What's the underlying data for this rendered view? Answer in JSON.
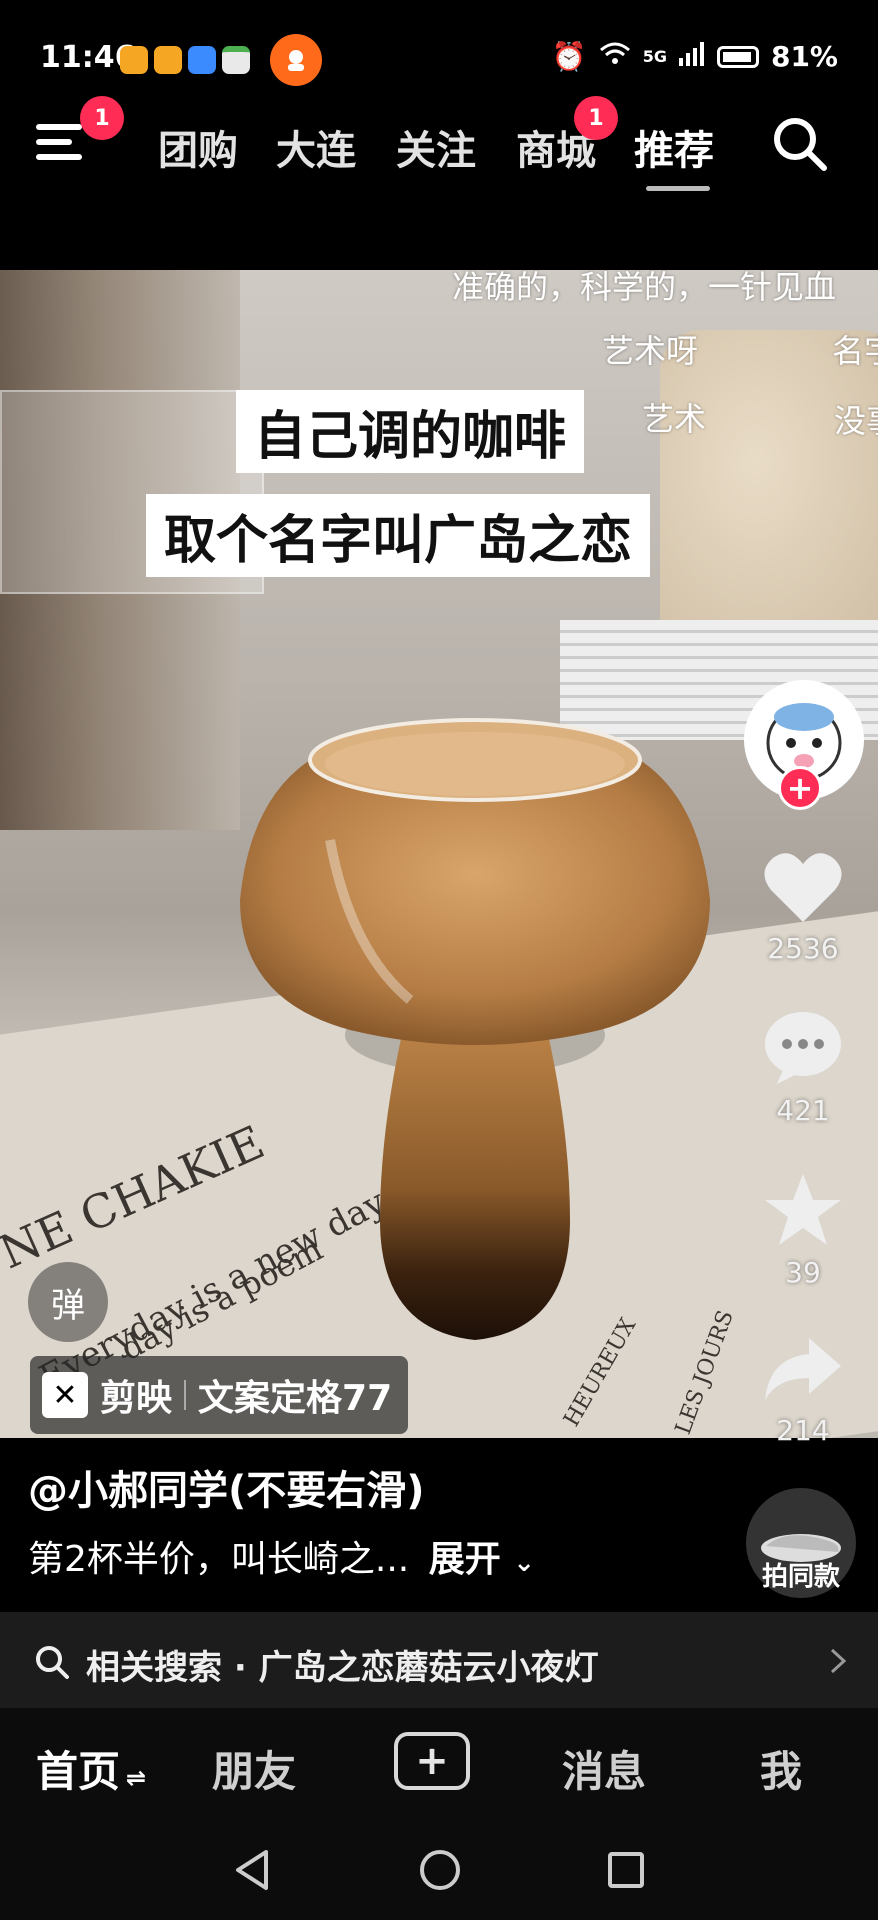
{
  "status_bar": {
    "time": "11:46",
    "network": "5G",
    "battery": "81%"
  },
  "top_nav": {
    "menu_badge": "1",
    "tabs": [
      {
        "label": "团购"
      },
      {
        "label": "大连"
      },
      {
        "label": "关注"
      },
      {
        "label": "商城",
        "badge": "1"
      },
      {
        "label": "推荐",
        "active": true
      }
    ]
  },
  "video": {
    "captions": [
      "自己调的咖啡",
      "取个名字叫广岛之恋"
    ],
    "danmaku": [
      "准确的，科学的，一针见血",
      "艺术呀",
      "名字",
      "艺术",
      "没事"
    ],
    "danmaku_toggle": "弹",
    "source_app": "剪映",
    "source_template": "文案定格77",
    "mat_text_1": "NE CHAKIE",
    "mat_text_2": "Everyday is a new day",
    "mat_text_3": "day is a poem",
    "mat_text_4": "HEUREUX",
    "mat_text_5": "LES JOURS"
  },
  "actions": {
    "like_count": "2536",
    "comment_count": "421",
    "favorite_count": "39",
    "share_count": "214"
  },
  "post": {
    "author": "@小郝同学(不要右滑)",
    "description": "第2杯半价，叫长崎之...",
    "expand_label": "展开",
    "same_style_label": "拍同款"
  },
  "related_search": {
    "label": "相关搜索 · 广岛之恋蘑菇云小夜灯"
  },
  "bottom_tabs": [
    {
      "label": "首页"
    },
    {
      "label": "朋友"
    },
    {
      "label": "消息"
    },
    {
      "label": "我"
    }
  ],
  "colors": {
    "accent_red": "#ff2d55",
    "background": "#000000"
  }
}
